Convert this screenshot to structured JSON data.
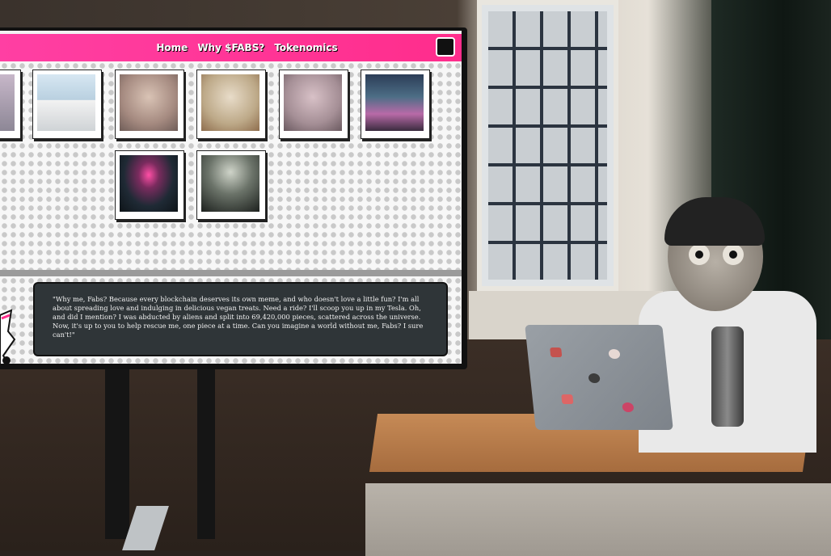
{
  "navbar": {
    "links": [
      "Home",
      "Why $FABS?",
      "Tokenomics"
    ]
  },
  "gallery": {
    "row1": [
      "fabs-card-partial",
      "fabs-in-tesla",
      "fabs-wide-eyed",
      "fabs-with-vegan-food",
      "fabs-dj",
      "fabs-dancing"
    ],
    "row2": [
      "ufo-abduction",
      "fabs-abducted"
    ]
  },
  "bio": {
    "text": "\"Why me, Fabs? Because every blockchain deserves its own meme, and who doesn't love a little fun? I'm all about spreading love and indulging in delicious vegan treats. Need a ride? I'll scoop you up in my Tesla. Oh, and did I mention? I was abducted by aliens and split into 69,420,000 pieces, scattered across the universe. Now, it's up to you to help rescue me, one piece at a time. Can you imagine a world without me, Fabs? I sure can't!\""
  },
  "colors": {
    "navbar_pink": "#ff2d8c",
    "bio_box": "#2f3538"
  },
  "icons": {
    "nav_logo": "fabs-logo-icon"
  }
}
